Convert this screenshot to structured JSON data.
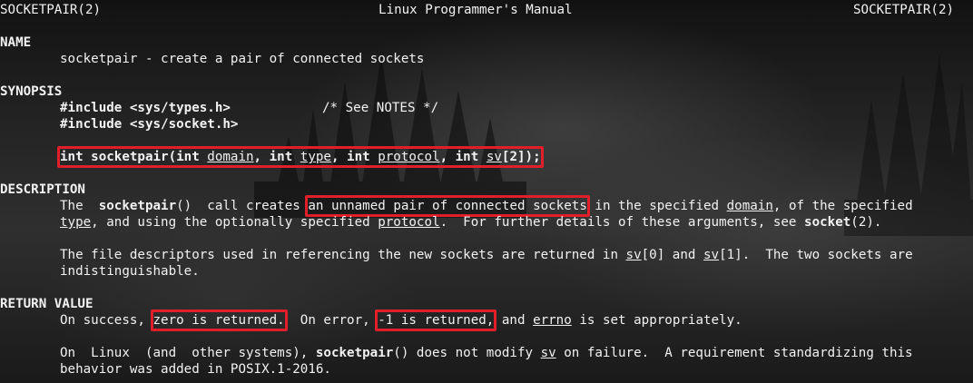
{
  "header": {
    "left": "SOCKETPAIR(2)",
    "center": "Linux Programmer's Manual",
    "right": "SOCKETPAIR(2)"
  },
  "name": {
    "heading": "NAME",
    "text": "socketpair - create a pair of connected sockets"
  },
  "synopsis": {
    "heading": "SYNOPSIS",
    "include1": "#include <sys/types.h>",
    "comment": "/* See NOTES */",
    "include2": "#include <sys/socket.h>",
    "proto": {
      "p1": "int socketpair(int ",
      "domain": "domain",
      "p2": ", int ",
      "type": "type",
      "p3": ", int ",
      "protocol": "protocol",
      "p4": ", int ",
      "sv": "sv",
      "p5": "[2]);"
    }
  },
  "description": {
    "heading": "DESCRIPTION",
    "l1a": "The  ",
    "l1b": "socketpair",
    "l1c": "()  call creates ",
    "l1d": "an unnamed pair of connected sockets",
    "l1e": " in the specified ",
    "l1f": "domain",
    "l1g": ", of the specified",
    "l2a": "type",
    "l2b": ", and using the optionally specified ",
    "l2c": "protocol",
    "l2d": ".  For further details of these arguments, see ",
    "l2e": "socket",
    "l2f": "(2).",
    "l3a": "The file descriptors used in referencing the new sockets are returned in ",
    "l3b": "sv",
    "l3c": "[0] and ",
    "l3d": "sv",
    "l3e": "[1].  The two sockets are",
    "l4": "indistinguishable."
  },
  "return_value": {
    "heading": "RETURN VALUE",
    "l1a": "On success, ",
    "l1b": "zero is returned.",
    "l1c": "  On error, ",
    "l1d": "-1 is returned,",
    "l1e": " and ",
    "l1f": "errno",
    "l1g": " is set appropriately.",
    "l2a": "On  Linux  (and  other systems), ",
    "l2b": "socketpair",
    "l2c": "() does not modify ",
    "l2d": "sv",
    "l2e": " on failure.  A requirement standardizing this",
    "l3": "behavior was added in POSIX.1-2016."
  },
  "colors": {
    "highlight_box": "#e01f2b",
    "text": "#f2f2f2",
    "background": "#1e1e1e"
  }
}
